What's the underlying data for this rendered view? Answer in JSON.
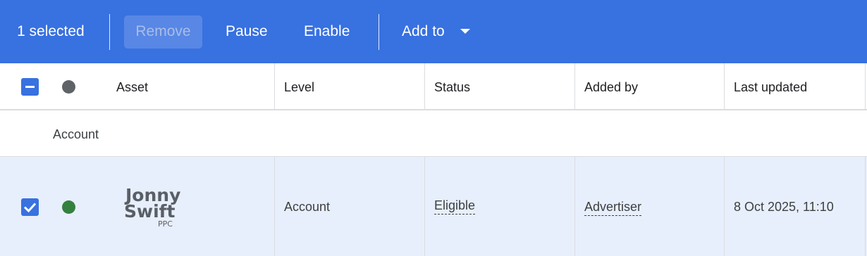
{
  "toolbar": {
    "selected_text": "1 selected",
    "remove_label": "Remove",
    "pause_label": "Pause",
    "enable_label": "Enable",
    "add_to_label": "Add to",
    "background": "#3871e0"
  },
  "table": {
    "columns": [
      "Asset",
      "Level",
      "Status",
      "Added by",
      "Last updated"
    ],
    "group_label": "Account",
    "rows": [
      {
        "selected": true,
        "status_dot": "green",
        "asset_logo": {
          "line1": "Jonny",
          "line2": "Swift",
          "line3": "PPC"
        },
        "level": "Account",
        "status": "Eligible",
        "added_by": "Advertiser",
        "last_updated": "8 Oct 2025, 11:10"
      }
    ]
  },
  "colors": {
    "accent": "#3871e0",
    "status_green": "#34803f",
    "status_grey": "#5f6368",
    "selected_row": "#e8effc"
  }
}
